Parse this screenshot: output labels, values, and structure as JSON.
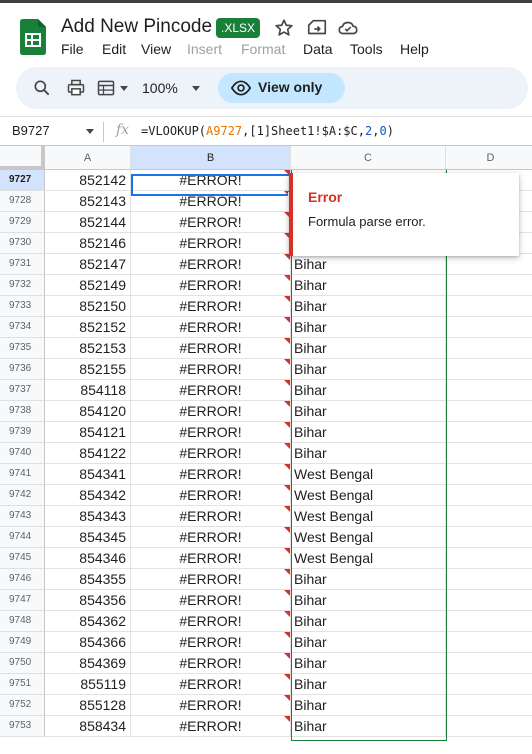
{
  "header": {
    "title": "Add New Pincode",
    "badge": ".XLSX",
    "menu": [
      {
        "label": "File",
        "disabled": false
      },
      {
        "label": "Edit",
        "disabled": false
      },
      {
        "label": "View",
        "disabled": false
      },
      {
        "label": "Insert",
        "disabled": true
      },
      {
        "label": "Format",
        "disabled": true
      },
      {
        "label": "Data",
        "disabled": false
      },
      {
        "label": "Tools",
        "disabled": false
      },
      {
        "label": "Help",
        "disabled": false
      }
    ]
  },
  "toolbar": {
    "zoom": "100%",
    "view_only_label": "View only"
  },
  "formula_bar": {
    "cell_ref": "B9727",
    "fx": "fx",
    "formula_parts": [
      {
        "text": "=VLOOKUP(",
        "kind": "plain"
      },
      {
        "text": "A9727",
        "kind": "ref"
      },
      {
        "text": ",[1]Sheet1!$A:$C,",
        "kind": "plain"
      },
      {
        "text": "2",
        "kind": "num"
      },
      {
        "text": ",",
        "kind": "plain"
      },
      {
        "text": "0",
        "kind": "num"
      },
      {
        "text": ")",
        "kind": "plain"
      }
    ]
  },
  "grid": {
    "columns": [
      "A",
      "B",
      "C",
      "D"
    ],
    "selected_column": "B",
    "selected_row": "9727",
    "rows": [
      {
        "num": "9727",
        "a": "852142",
        "b": "#ERROR!",
        "c": ""
      },
      {
        "num": "9728",
        "a": "852143",
        "b": "#ERROR!",
        "c": ""
      },
      {
        "num": "9729",
        "a": "852144",
        "b": "#ERROR!",
        "c": ""
      },
      {
        "num": "9730",
        "a": "852146",
        "b": "#ERROR!",
        "c": ""
      },
      {
        "num": "9731",
        "a": "852147",
        "b": "#ERROR!",
        "c": "Bihar"
      },
      {
        "num": "9732",
        "a": "852149",
        "b": "#ERROR!",
        "c": "Bihar"
      },
      {
        "num": "9733",
        "a": "852150",
        "b": "#ERROR!",
        "c": "Bihar"
      },
      {
        "num": "9734",
        "a": "852152",
        "b": "#ERROR!",
        "c": "Bihar"
      },
      {
        "num": "9735",
        "a": "852153",
        "b": "#ERROR!",
        "c": "Bihar"
      },
      {
        "num": "9736",
        "a": "852155",
        "b": "#ERROR!",
        "c": "Bihar"
      },
      {
        "num": "9737",
        "a": "854118",
        "b": "#ERROR!",
        "c": "Bihar"
      },
      {
        "num": "9738",
        "a": "854120",
        "b": "#ERROR!",
        "c": "Bihar"
      },
      {
        "num": "9739",
        "a": "854121",
        "b": "#ERROR!",
        "c": "Bihar"
      },
      {
        "num": "9740",
        "a": "854122",
        "b": "#ERROR!",
        "c": "Bihar"
      },
      {
        "num": "9741",
        "a": "854341",
        "b": "#ERROR!",
        "c": "West Bengal"
      },
      {
        "num": "9742",
        "a": "854342",
        "b": "#ERROR!",
        "c": "West Bengal"
      },
      {
        "num": "9743",
        "a": "854343",
        "b": "#ERROR!",
        "c": "West Bengal"
      },
      {
        "num": "9744",
        "a": "854345",
        "b": "#ERROR!",
        "c": "West Bengal"
      },
      {
        "num": "9745",
        "a": "854346",
        "b": "#ERROR!",
        "c": "West Bengal"
      },
      {
        "num": "9746",
        "a": "854355",
        "b": "#ERROR!",
        "c": "Bihar"
      },
      {
        "num": "9747",
        "a": "854356",
        "b": "#ERROR!",
        "c": "Bihar"
      },
      {
        "num": "9748",
        "a": "854362",
        "b": "#ERROR!",
        "c": "Bihar"
      },
      {
        "num": "9749",
        "a": "854366",
        "b": "#ERROR!",
        "c": "Bihar"
      },
      {
        "num": "9750",
        "a": "854369",
        "b": "#ERROR!",
        "c": "Bihar"
      },
      {
        "num": "9751",
        "a": "855119",
        "b": "#ERROR!",
        "c": "Bihar"
      },
      {
        "num": "9752",
        "a": "855128",
        "b": "#ERROR!",
        "c": "Bihar"
      },
      {
        "num": "9753",
        "a": "858434",
        "b": "#ERROR!",
        "c": "Bihar"
      }
    ]
  },
  "error_popup": {
    "title": "Error",
    "message": "Formula parse error."
  },
  "colors": {
    "sheets_green": "#188038",
    "error_red": "#d93025",
    "selection_blue": "#1a73e8",
    "view_only_bg": "#c2e7ff"
  },
  "icons": [
    "sheets-logo-icon",
    "star-icon",
    "move-icon",
    "cloud-icon",
    "search-icon",
    "print-icon",
    "format-icon",
    "eye-icon"
  ]
}
